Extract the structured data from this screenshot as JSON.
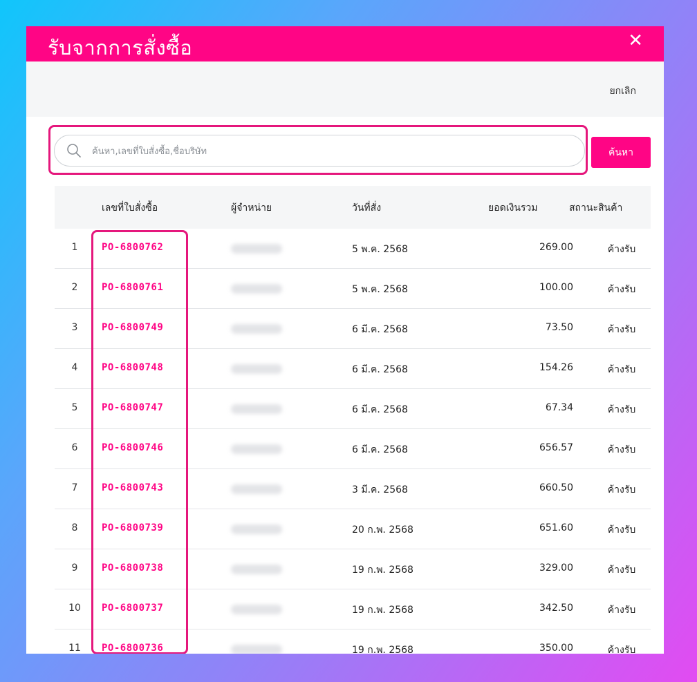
{
  "modal": {
    "title": "รับจากการสั่งซื้อ",
    "close_symbol": "✕",
    "cancel_label": "ยกเลิก",
    "accent_color": "#ff0585"
  },
  "search": {
    "placeholder": "ค้นหา,เลขที่ใบสั่งซื้อ,ชื่อบริษัท",
    "value": "",
    "button_label": "ค้นหา"
  },
  "table": {
    "headers": {
      "no": "",
      "po_number": "เลขที่ใบสั่งซื้อ",
      "supplier": "ผู้จำหน่าย",
      "order_date": "วันที่สั่ง",
      "total": "ยอดเงินรวม",
      "status": "สถานะสินค้า"
    },
    "rows": [
      {
        "no": "1",
        "po": "PO-6800762",
        "date": "5 พ.ค. 2568",
        "amount": "269.00",
        "status": "ค้างรับ"
      },
      {
        "no": "2",
        "po": "PO-6800761",
        "date": "5 พ.ค. 2568",
        "amount": "100.00",
        "status": "ค้างรับ"
      },
      {
        "no": "3",
        "po": "PO-6800749",
        "date": "6 มี.ค. 2568",
        "amount": "73.50",
        "status": "ค้างรับ"
      },
      {
        "no": "4",
        "po": "PO-6800748",
        "date": "6 มี.ค. 2568",
        "amount": "154.26",
        "status": "ค้างรับ"
      },
      {
        "no": "5",
        "po": "PO-6800747",
        "date": "6 มี.ค. 2568",
        "amount": "67.34",
        "status": "ค้างรับ"
      },
      {
        "no": "6",
        "po": "PO-6800746",
        "date": "6 มี.ค. 2568",
        "amount": "656.57",
        "status": "ค้างรับ"
      },
      {
        "no": "7",
        "po": "PO-6800743",
        "date": "3 มี.ค. 2568",
        "amount": "660.50",
        "status": "ค้างรับ"
      },
      {
        "no": "8",
        "po": "PO-6800739",
        "date": "20 ก.พ. 2568",
        "amount": "651.60",
        "status": "ค้างรับ"
      },
      {
        "no": "9",
        "po": "PO-6800738",
        "date": "19 ก.พ. 2568",
        "amount": "329.00",
        "status": "ค้างรับ"
      },
      {
        "no": "10",
        "po": "PO-6800737",
        "date": "19 ก.พ. 2568",
        "amount": "342.50",
        "status": "ค้างรับ"
      },
      {
        "no": "11",
        "po": "PO-6800736",
        "date": "19 ก.พ. 2568",
        "amount": "350.00",
        "status": "ค้างรับ"
      }
    ]
  }
}
